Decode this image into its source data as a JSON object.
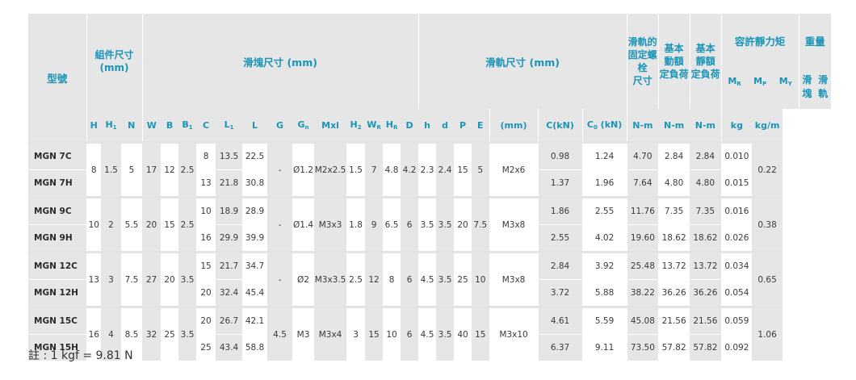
{
  "header": {
    "model": "型號",
    "assembly": [
      "組件尺寸",
      "(mm)"
    ],
    "block": "滑塊尺寸 (mm)",
    "rail": "滑軌尺寸 (mm)",
    "bolt": [
      "滑軌的",
      "固定螺栓",
      "尺寸"
    ],
    "dynamic": [
      "基本",
      "動額",
      "定負荷"
    ],
    "static": [
      "基本",
      "靜額",
      "定負荷"
    ],
    "moment": "容許靜力矩",
    "weight": "重量",
    "block_w": "滑塊",
    "rail_w": "滑軌",
    "mr_main": "M",
    "mr_sub": "R",
    "mp_main": "M",
    "mp_sub": "P",
    "my_main": "M",
    "my_sub": "Y"
  },
  "columns": [
    {
      "main": "H",
      "sub": ""
    },
    {
      "main": "H",
      "sub": "1"
    },
    {
      "main": "N",
      "sub": ""
    },
    {
      "main": "W",
      "sub": ""
    },
    {
      "main": "B",
      "sub": ""
    },
    {
      "main": "B",
      "sub": "1"
    },
    {
      "main": "C",
      "sub": ""
    },
    {
      "main": "L",
      "sub": "1"
    },
    {
      "main": "L",
      "sub": ""
    },
    {
      "main": "G",
      "sub": ""
    },
    {
      "main": "G",
      "sub": "n"
    },
    {
      "main": "Mxl",
      "sub": ""
    },
    {
      "main": "H",
      "sub": "2"
    },
    {
      "main": "W",
      "sub": "R"
    },
    {
      "main": "H",
      "sub": "R"
    },
    {
      "main": "D",
      "sub": ""
    },
    {
      "main": "h",
      "sub": ""
    },
    {
      "main": "d",
      "sub": ""
    },
    {
      "main": "P",
      "sub": ""
    },
    {
      "main": "E",
      "sub": ""
    },
    {
      "main": "(mm)",
      "sub": ""
    },
    {
      "main": "C(kN)",
      "sub": ""
    },
    {
      "main": "C",
      "sub": "0",
      "tail": " (kN)"
    },
    {
      "main": "N-m",
      "sub": ""
    },
    {
      "main": "N-m",
      "sub": ""
    },
    {
      "main": "N-m",
      "sub": ""
    },
    {
      "main": "kg",
      "sub": ""
    },
    {
      "main": "kg/m",
      "sub": ""
    }
  ],
  "groups": [
    {
      "rows": [
        {
          "model": "MGN 7C",
          "C": "8",
          "L1": "13.5",
          "L": "22.5",
          "dyn": "0.98",
          "stat": "1.24",
          "MR": "4.70",
          "MP": "2.84",
          "MY": "2.84",
          "wb": "0.010"
        },
        {
          "model": "MGN 7H",
          "C": "13",
          "L1": "21.8",
          "L": "30.8",
          "dyn": "1.37",
          "stat": "1.96",
          "MR": "7.64",
          "MP": "4.80",
          "MY": "4.80",
          "wb": "0.015"
        }
      ],
      "H": "8",
      "H1": "1.5",
      "N": "5",
      "W": "17",
      "B": "12",
      "B1": "2.5",
      "G": "-",
      "Gn": "Ø1.2",
      "Mxl": "M2x2.5",
      "H2": "1.5",
      "WR": "7",
      "HR": "4.8",
      "D": "4.2",
      "h": "2.3",
      "d": "2.4",
      "P": "15",
      "E": "5",
      "bolt": "M2x6",
      "wr": "0.22"
    },
    {
      "rows": [
        {
          "model": "MGN 9C",
          "C": "10",
          "L1": "18.9",
          "L": "28.9",
          "dyn": "1.86",
          "stat": "2.55",
          "MR": "11.76",
          "MP": "7.35",
          "MY": "7.35",
          "wb": "0.016"
        },
        {
          "model": "MGN 9H",
          "C": "16",
          "L1": "29.9",
          "L": "39.9",
          "dyn": "2.55",
          "stat": "4.02",
          "MR": "19.60",
          "MP": "18.62",
          "MY": "18.62",
          "wb": "0.026"
        }
      ],
      "H": "10",
      "H1": "2",
      "N": "5.5",
      "W": "20",
      "B": "15",
      "B1": "2.5",
      "G": "-",
      "Gn": "Ø1.4",
      "Mxl": "M3x3",
      "H2": "1.8",
      "WR": "9",
      "HR": "6.5",
      "D": "6",
      "h": "3.5",
      "d": "3.5",
      "P": "20",
      "E": "7.5",
      "bolt": "M3x8",
      "wr": "0.38"
    },
    {
      "rows": [
        {
          "model": "MGN 12C",
          "C": "15",
          "L1": "21.7",
          "L": "34.7",
          "dyn": "2.84",
          "stat": "3.92",
          "MR": "25.48",
          "MP": "13.72",
          "MY": "13.72",
          "wb": "0.034"
        },
        {
          "model": "MGN 12H",
          "C": "20",
          "L1": "32.4",
          "L": "45.4",
          "dyn": "3.72",
          "stat": "5.88",
          "MR": "38.22",
          "MP": "36.26",
          "MY": "36.26",
          "wb": "0.054"
        }
      ],
      "H": "13",
      "H1": "3",
      "N": "7.5",
      "W": "27",
      "B": "20",
      "B1": "3.5",
      "G": "-",
      "Gn": "Ø2",
      "Mxl": "M3x3.5",
      "H2": "2.5",
      "WR": "12",
      "HR": "8",
      "D": "6",
      "h": "4.5",
      "d": "3.5",
      "P": "25",
      "E": "10",
      "bolt": "M3x8",
      "wr": "0.65"
    },
    {
      "rows": [
        {
          "model": "MGN 15C",
          "C": "20",
          "L1": "26.7",
          "L": "42.1",
          "dyn": "4.61",
          "stat": "5.59",
          "MR": "45.08",
          "MP": "21.56",
          "MY": "21.56",
          "wb": "0.059"
        },
        {
          "model": "MGN 15H",
          "C": "25",
          "L1": "43.4",
          "L": "58.8",
          "dyn": "6.37",
          "stat": "9.11",
          "MR": "73.50",
          "MP": "57.82",
          "MY": "57.82",
          "wb": "0.092"
        }
      ],
      "H": "16",
      "H1": "4",
      "N": "8.5",
      "W": "32",
      "B": "25",
      "B1": "3.5",
      "G": "4.5",
      "Gn": "M3",
      "Mxl": "M3x4",
      "H2": "3",
      "WR": "15",
      "HR": "10",
      "D": "6",
      "h": "4.5",
      "d": "3.5",
      "P": "40",
      "E": "15",
      "bolt": "M3x10",
      "wr": "1.06"
    }
  ],
  "note": "註 : 1 kgf = 9.81 N",
  "colors": {
    "header_text": "#1a95b8",
    "shade": "#e6e6e6"
  }
}
